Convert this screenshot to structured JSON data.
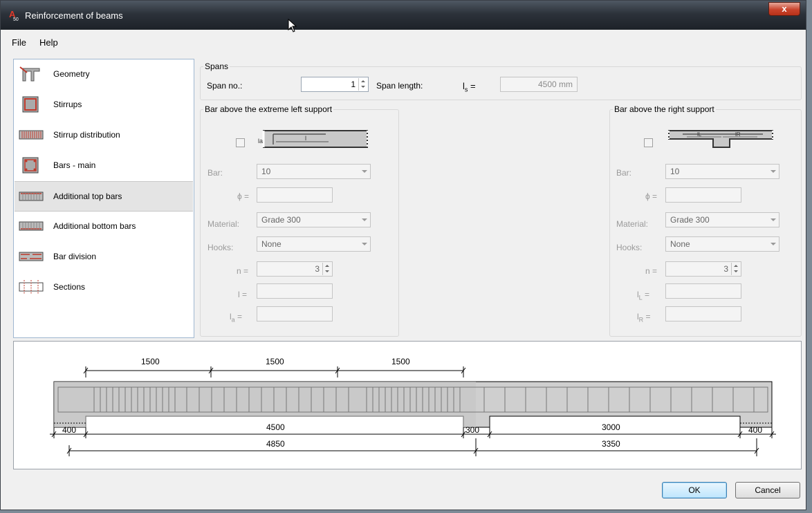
{
  "window": {
    "title": "Reinforcement of beams",
    "close_label": "x"
  },
  "menu": {
    "file": "File",
    "help": "Help"
  },
  "nav": {
    "items": [
      {
        "label": "Geometry",
        "icon": "geometry-icon"
      },
      {
        "label": "Stirrups",
        "icon": "stirrups-icon"
      },
      {
        "label": "Stirrup distribution",
        "icon": "stirrup-distribution-icon"
      },
      {
        "label": "Bars - main",
        "icon": "bars-main-icon"
      },
      {
        "label": "Additional top bars",
        "icon": "additional-top-bars-icon",
        "selected": true
      },
      {
        "label": "Additional bottom bars",
        "icon": "additional-bottom-bars-icon"
      },
      {
        "label": "Bar division",
        "icon": "bar-division-icon"
      },
      {
        "label": "Sections",
        "icon": "sections-icon"
      }
    ]
  },
  "spans": {
    "legend": "Spans",
    "span_no_label": "Span no.:",
    "span_no_value": "1",
    "span_length_label": "Span length:",
    "ls_label": "l",
    "ls_sub": "s",
    "ls_eq": "=",
    "ls_value": "4500 mm"
  },
  "left_support": {
    "legend": "Bar above the extreme left support",
    "bar_label": "Bar:",
    "bar_value": "10",
    "phi_label": "ϕ =",
    "phi_value": "",
    "material_label": "Material:",
    "material_value": "Grade 300",
    "hooks_label": "Hooks:",
    "hooks_value": "None",
    "n_label": "n =",
    "n_value": "3",
    "l_label": "l =",
    "l_value": "",
    "la_label": "l",
    "la_sub": "a",
    "la_eq": "=",
    "la_value": "",
    "pic_la": "la",
    "pic_l": "l"
  },
  "right_support": {
    "legend": "Bar above the right support",
    "bar_label": "Bar:",
    "bar_value": "10",
    "phi_label": "ϕ =",
    "phi_value": "",
    "material_label": "Material:",
    "material_value": "Grade 300",
    "hooks_label": "Hooks:",
    "hooks_value": "None",
    "n_label": "n =",
    "n_value": "3",
    "ll_label": "l",
    "ll_sub": "L",
    "ll_eq": "=",
    "ll_value": "",
    "lr_label": "l",
    "lr_sub": "R",
    "lr_eq": "=",
    "lr_value": "",
    "pic_l": "lL",
    "pic_r": "lR"
  },
  "beam": {
    "top_dims": [
      "1500",
      "1500",
      "1500"
    ],
    "support_left": "400",
    "span1": "4500",
    "support_mid": "300",
    "span2": "3000",
    "support_right": "400",
    "total1": "4850",
    "total2": "3350"
  },
  "buttons": {
    "ok": "OK",
    "cancel": "Cancel"
  },
  "colors": {
    "accent_red": "#c0392b",
    "selection": "#e4e4e4"
  }
}
